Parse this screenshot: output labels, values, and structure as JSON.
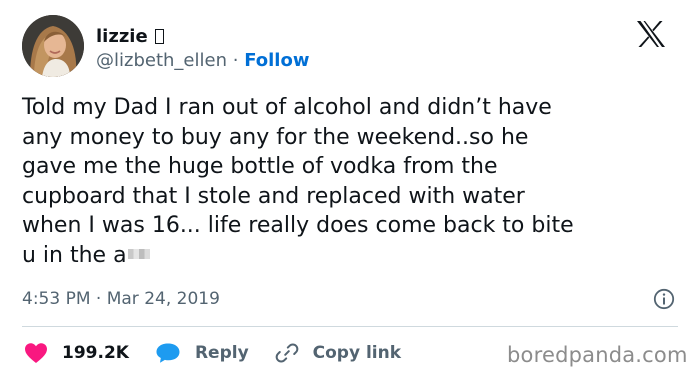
{
  "author": {
    "display_name": "lizzie",
    "handle": "@lizbeth_ellen",
    "separator": "·",
    "follow_label": "Follow"
  },
  "tweet": {
    "text": "Told my Dad I ran out of alcohol and didn’t have\nany money to buy any for the weekend..so he\ngave me the huge bottle of vodka from the\ncupboard that I stole and replaced with water\nwhen I was 16... life really does come back to bite\nu in the a",
    "timestamp": "4:53 PM · Mar 24, 2019"
  },
  "actions": {
    "likes": "199.2K",
    "reply_label": "Reply",
    "copy_link_label": "Copy link"
  },
  "watermark": "boredpanda.com",
  "icons": {
    "brand": "x-logo-icon",
    "info": "info-icon",
    "like": "heart-icon",
    "reply": "speech-bubble-icon",
    "copy": "link-icon"
  },
  "colors": {
    "text": "#0f1419",
    "muted": "#536471",
    "link": "#006fd6",
    "like": "#f91880",
    "reply": "#1d9bf0",
    "divider": "#cfd9de"
  }
}
